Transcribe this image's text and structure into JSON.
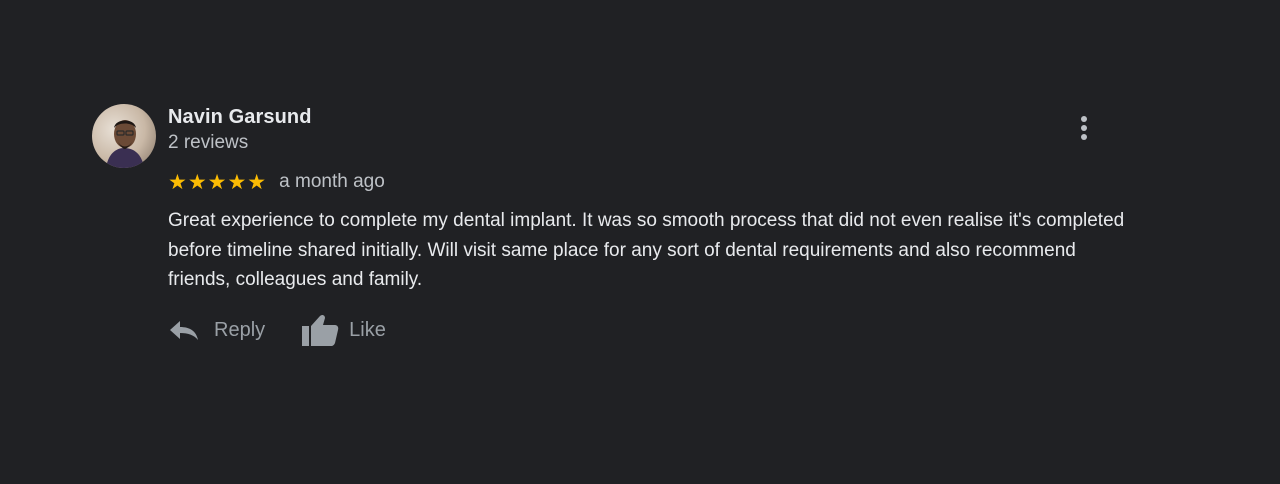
{
  "review": {
    "author_name": "Navin Garsund",
    "author_meta": "2 reviews",
    "rating": 5,
    "rating_max": 5,
    "stars_text": "★★★★★",
    "date": "a month ago",
    "text": "Great experience to complete my dental implant. It was so smooth process that did not even realise it's completed before timeline shared initially. Will visit same place for any sort of dental requirements and also recommend friends, colleagues and family.",
    "actions": {
      "reply_label": "Reply",
      "like_label": "Like"
    },
    "icons": {
      "avatar": "avatar-photo",
      "more": "more-vert-icon",
      "reply": "reply-arrow-icon",
      "like": "thumbs-up-icon"
    }
  },
  "colors": {
    "background": "#202124",
    "primary_text": "#e8eaed",
    "secondary_text": "#bdc1c6",
    "star": "#fbbc04",
    "action_icon": "#9aa0a6"
  }
}
